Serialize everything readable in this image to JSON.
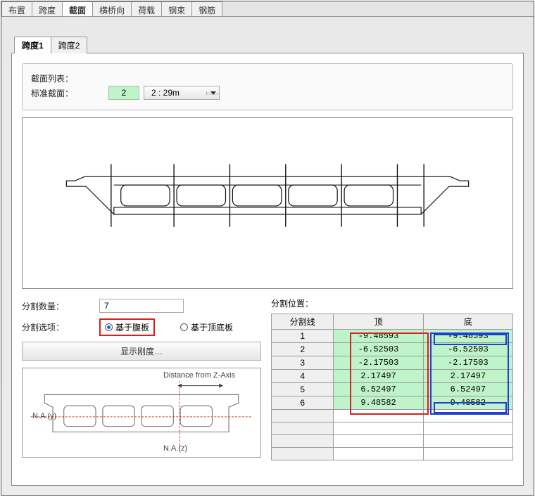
{
  "mainTabs": {
    "t0": "布置",
    "t1": "跨度",
    "t2": "截面",
    "t3": "横桥向",
    "t4": "荷载",
    "t5": "钢束",
    "t6": "钢筋"
  },
  "subTabs": {
    "t0": "跨度1",
    "t1": "跨度2"
  },
  "sectionList": {
    "listLabel": "截面列表：",
    "stdLabel": "标准截面：",
    "num": "2",
    "combo": "2 : 29m"
  },
  "split": {
    "countLabel": "分割数量：",
    "countValue": "7",
    "optionLabel": "分割选项：",
    "opt1": "基于腹板",
    "opt2": "基于顶底板",
    "stiffBtn": "显示刚度…"
  },
  "diag": {
    "dist": "Distance from Z-Axis",
    "nay": "N.A.(y)",
    "naz": "N.A.(z)"
  },
  "splitPos": {
    "title": "分割位置：",
    "h0": "分割线",
    "h1": "顶",
    "h2": "底",
    "rows": [
      {
        "n": "1",
        "top": "-9.48593",
        "bot": "-9.48593"
      },
      {
        "n": "2",
        "top": "-6.52503",
        "bot": "-6.52503"
      },
      {
        "n": "3",
        "top": "-2.17503",
        "bot": "-2.17503"
      },
      {
        "n": "4",
        "top": "2.17497",
        "bot": "2.17497"
      },
      {
        "n": "5",
        "top": "6.52497",
        "bot": "6.52497"
      },
      {
        "n": "6",
        "top": "9.48582",
        "bot": "9.48582"
      }
    ]
  }
}
